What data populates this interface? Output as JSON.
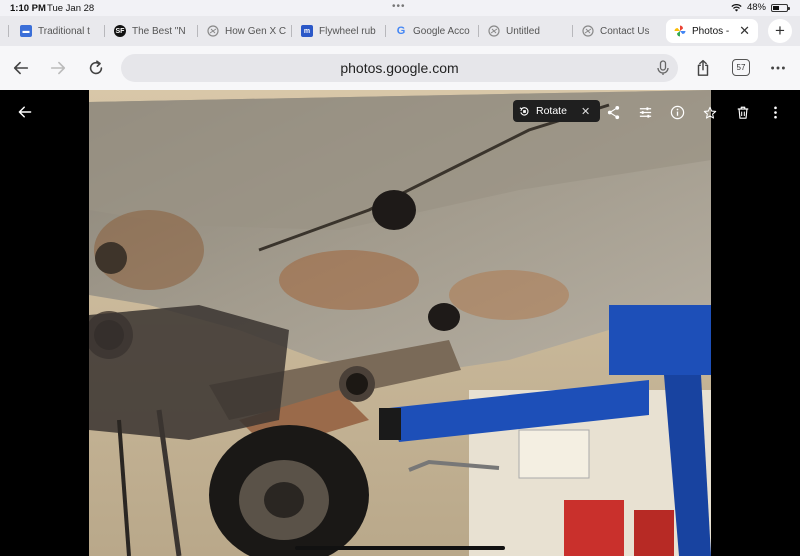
{
  "status_bar": {
    "time": "1:10 PM",
    "date": "Tue Jan 28",
    "battery": "48%",
    "battery_level": 0.48
  },
  "tabs": [
    {
      "label": "Traditional t",
      "icon": "blue-square-icon",
      "color": "#3b6fd8"
    },
    {
      "label": "The Best \"N",
      "icon": "black-circle-icon",
      "color": "#111111"
    },
    {
      "label": "How Gen X C",
      "icon": "globe-icon",
      "color": "#8a8a8a"
    },
    {
      "label": "Flywheel rub",
      "icon": "blue-logo-icon",
      "color": "#2b58c8"
    },
    {
      "label": "Google Acco",
      "icon": "google-g-icon",
      "color": "#ffffff"
    },
    {
      "label": "Untitled",
      "icon": "globe-icon",
      "color": "#8a8a8a"
    },
    {
      "label": "Contact Us",
      "icon": "globe-icon",
      "color": "#8a8a8a"
    },
    {
      "label": "Photos -",
      "icon": "google-photos-icon",
      "color": "#ffffff",
      "active": true
    }
  ],
  "toolbar": {
    "url": "photos.google.com",
    "tab_count": "57"
  },
  "viewer": {
    "rotate_label": "Rotate"
  },
  "colors": {
    "tab_bar": "#e9e9ed",
    "toolbar": "#f7f7f9",
    "viewer_bg": "#000000",
    "lift_blue": "#1d4fb8"
  }
}
